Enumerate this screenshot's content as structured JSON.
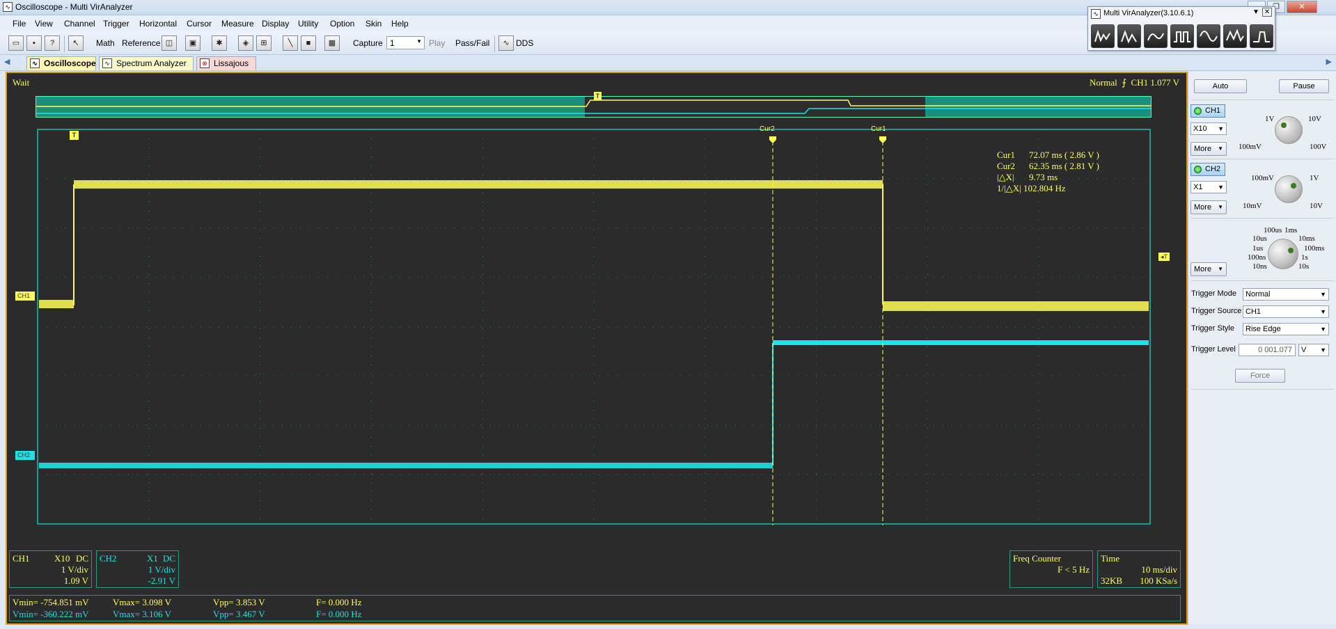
{
  "window": {
    "title": "Oscilloscope - Multi VirAnalyzer"
  },
  "menu": [
    "File",
    "View",
    "Channel",
    "Trigger",
    "Horizontal",
    "Cursor",
    "Measure",
    "Display",
    "Utility",
    "Option",
    "Skin",
    "Help"
  ],
  "toolbar": {
    "math": "Math",
    "reference": "Reference",
    "capture_label": "Capture",
    "capture_value": "1",
    "play": "Play",
    "passfail": "Pass/Fail",
    "dds": "DDS"
  },
  "tabs": [
    "Oscilloscope",
    "Spectrum Analyzer",
    "Lissajous"
  ],
  "mini_window": {
    "title": "Multi VirAnalyzer(3.10.6.1)"
  },
  "scope": {
    "status": "Wait",
    "trigger_status": {
      "mode": "Normal",
      "source": "CH1",
      "level": "1.077 V"
    },
    "markers": {
      "trigger": "T",
      "cur1": "Cur1",
      "cur2": "Cur2",
      "ch1": "CH1",
      "ch2": "CH2"
    },
    "cursor_readout": {
      "cur1": {
        "label": "Cur1",
        "value": "72.07 ms ( 2.86 V )"
      },
      "cur2": {
        "label": "Cur2",
        "value": "62.35 ms ( 2.81 V )"
      },
      "dx": {
        "label": "|△X|",
        "value": "9.73 ms"
      },
      "inv_dx": {
        "label": "1/|△X|",
        "value": "102.804 Hz"
      }
    }
  },
  "ch1_info": {
    "name": "CH1",
    "probe": "X10",
    "coupling": "DC",
    "scale": "1 V/div",
    "offset": "1.09 V"
  },
  "ch2_info": {
    "name": "CH2",
    "probe": "X1",
    "coupling": "DC",
    "scale": "1 V/div",
    "offset": "-2.91 V"
  },
  "freq_counter": {
    "title": "Freq Counter",
    "value": "F < 5 Hz"
  },
  "time_info": {
    "title": "Time",
    "scale": "10 ms/div",
    "memory": "32KB",
    "rate": "100 KSa/s"
  },
  "measurements": [
    {
      "vmin": "Vmin= -754.851 mV",
      "vmax": "Vmax= 3.098 V",
      "vpp": "Vpp= 3.853 V",
      "freq": "F= 0.000 Hz"
    },
    {
      "vmin": "Vmin= -360.222 mV",
      "vmax": "Vmax= 3.106 V",
      "vpp": "Vpp= 3.467 V",
      "freq": "F= 0.000 Hz"
    }
  ],
  "panel": {
    "auto": "Auto",
    "pause": "Pause",
    "ch1_button": "CH1",
    "ch1_probe": "X10",
    "more": "More",
    "ch1_knob": {
      "min": "100mV",
      "mid": "1V",
      "max": "10V",
      "max2": "100V"
    },
    "ch2_button": "CH2",
    "ch2_probe": "X1",
    "ch2_knob": {
      "min": "10mV",
      "mid": "100mV",
      "max": "1V",
      "max2": "10V"
    },
    "time_knob": [
      "100us",
      "1ms",
      "10us",
      "10ms",
      "1us",
      "100ms",
      "100ns",
      "1s",
      "10ns",
      "10s"
    ],
    "trigger_mode_label": "Trigger Mode",
    "trigger_mode": "Normal",
    "trigger_source_label": "Trigger Source",
    "trigger_source": "CH1",
    "trigger_style_label": "Trigger Style",
    "trigger_style": "Rise Edge",
    "trigger_level_label": "Trigger Level",
    "trigger_level_value": "0 001.077",
    "trigger_level_unit": "V",
    "force": "Force"
  },
  "colors": {
    "ch1": "#ffff55",
    "ch2": "#22e0e8",
    "grid_border": "#1c9a8c",
    "screen": "#2b2b2b"
  }
}
